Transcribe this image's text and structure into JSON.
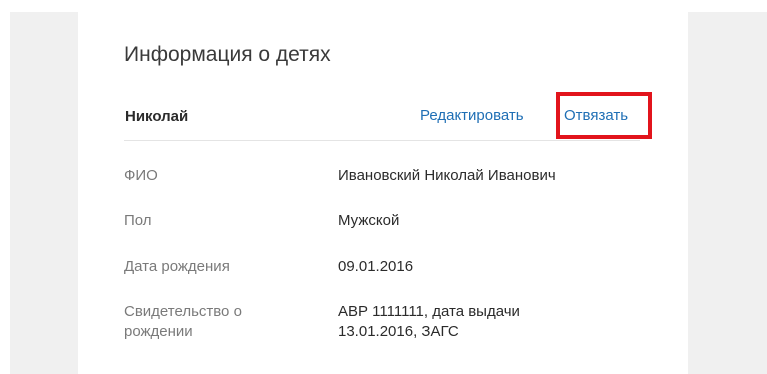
{
  "section": {
    "title": "Информация о детях"
  },
  "child": {
    "name": "Николай",
    "edit_label": "Редактировать",
    "unlink_label": "Отвязать"
  },
  "fields": [
    {
      "label": "ФИО",
      "value": "Ивановский Николай Иванович"
    },
    {
      "label": "Пол",
      "value": "Мужской"
    },
    {
      "label": "Дата рождения",
      "value": "09.01.2016"
    },
    {
      "label_line1": "Свидетельство о",
      "label_line2": "рождении",
      "value_line1": "АВР 1111111, дата выдачи",
      "value_line2": "13.01.2016, ЗАГС"
    }
  ],
  "colors": {
    "link": "#1f6fb5",
    "highlight": "#e2141c",
    "side_panels": "#f0f0f0"
  }
}
